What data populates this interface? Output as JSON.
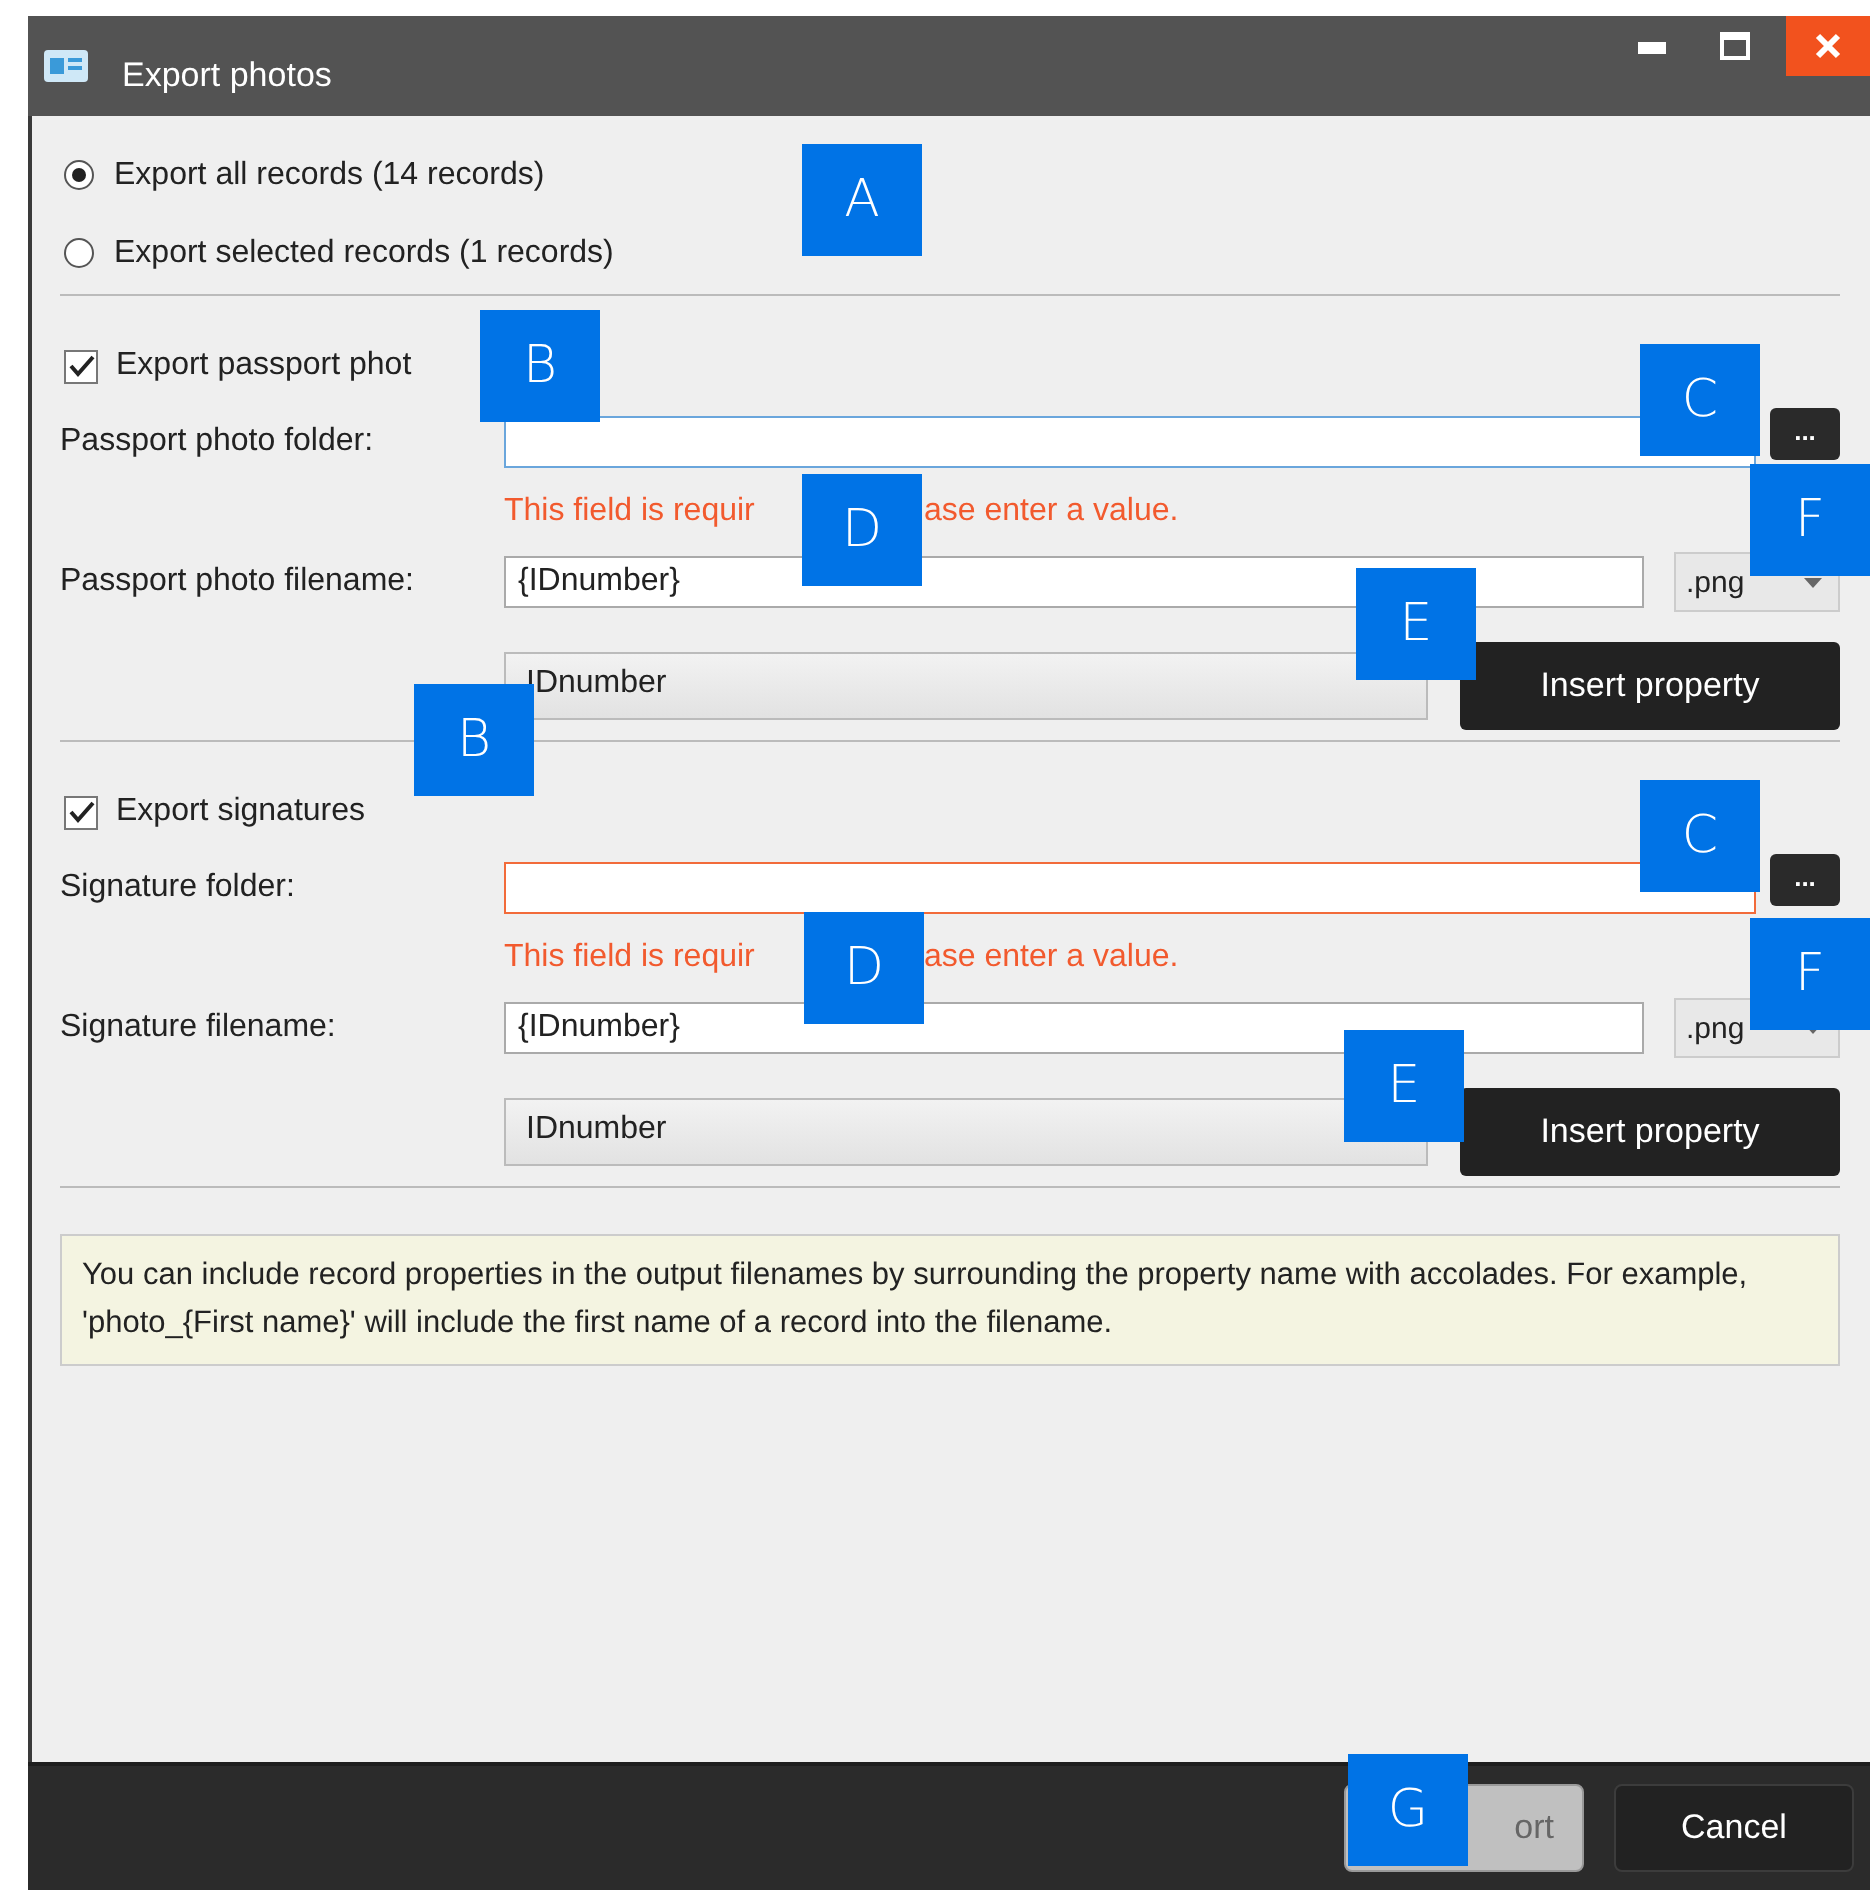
{
  "window": {
    "title": "Export photos"
  },
  "record_scope": [
    {
      "label": "Export all records (14 records)",
      "selected": true
    },
    {
      "label": "Export selected records (1 records)",
      "selected": false
    }
  ],
  "sections": [
    {
      "export_label": "Export passport phot",
      "checked": true,
      "folder_label": "Passport photo folder:",
      "folder_focused": true,
      "browse_button": "...",
      "error_parts": [
        "This field is requir",
        "ase enter a value."
      ],
      "filename_label": "Passport photo filename:",
      "filename_value": "{IDnumber}",
      "extension": ".png",
      "property": "IDnumber",
      "insert_button": "Insert property"
    },
    {
      "export_label": "Export signatures",
      "checked": true,
      "folder_label": "Signature folder:",
      "folder_focused": false,
      "browse_button": "...",
      "error_parts": [
        "This field is requir",
        "ase enter a value."
      ],
      "filename_label": "Signature filename:",
      "filename_value": "{IDnumber}",
      "extension": ".png",
      "property": "IDnumber",
      "insert_button": "Insert property"
    }
  ],
  "info_text": "You can include record properties in the output filenames by surrounding the property name with accolades. For example, 'photo_{First name}' will include the first name of a record into the filename.",
  "footer_buttons": [
    {
      "label": "ort",
      "disabled": true
    },
    {
      "label": "Cancel",
      "disabled": false
    }
  ],
  "callouts": [
    "A",
    "B",
    "C",
    "D",
    "F",
    "E",
    "B",
    "C",
    "D",
    "F",
    "E",
    "G"
  ]
}
